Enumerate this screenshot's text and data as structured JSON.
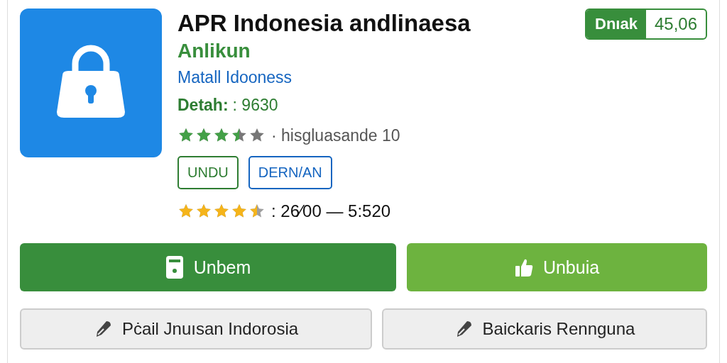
{
  "app": {
    "title": "APR Indonesia andlinaesa",
    "subtitle": "Anlikun",
    "developer": "Matall Idooness",
    "detail_label": "Detah:",
    "detail_value": ": 9630"
  },
  "badge": {
    "label": "Dnıak",
    "value": "45,06"
  },
  "rating": {
    "stars": 3.5,
    "text": "· hisgluasande 10"
  },
  "tags": [
    {
      "label": "UNDU",
      "color": "#2e7d32"
    },
    {
      "label": "DERN/AN",
      "color": "#1565c0"
    }
  ],
  "rating2": {
    "stars": 4.5,
    "text": ": 26⁄00 — 5:520"
  },
  "buttons": [
    {
      "kind": "primary",
      "label": "Unbem"
    },
    {
      "kind": "secondary",
      "label": "Unbuia"
    },
    {
      "kind": "plain",
      "label": "Pċail Jnuısan Indorosia"
    },
    {
      "kind": "plain",
      "label": "Baickaris Rennguna"
    }
  ]
}
